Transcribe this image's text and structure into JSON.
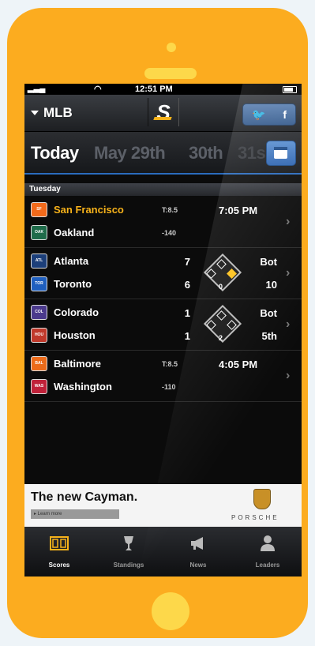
{
  "status": {
    "time": "12:51 PM"
  },
  "nav": {
    "league": "MLB",
    "social": {
      "twitter": "𝕥",
      "facebook": "f"
    }
  },
  "dates": {
    "today": "Today",
    "next1": "May 29th",
    "next2": "30th",
    "next3": "31s"
  },
  "section": {
    "day": "Tuesday"
  },
  "games": [
    {
      "away": {
        "name": "San Francisco",
        "abbr": "SF",
        "color": "#f26a1b",
        "highlight": "#f7b21a"
      },
      "home": {
        "name": "Oakland",
        "abbr": "OAK",
        "color": "#1f6b4a"
      },
      "line_top": "T:8.5",
      "line_bot": "-140",
      "time": "7:05 PM"
    },
    {
      "away": {
        "name": "Atlanta",
        "abbr": "ATL",
        "color": "#1c3f7a",
        "score": "7"
      },
      "home": {
        "name": "Toronto",
        "abbr": "TOR",
        "color": "#1f5fbf",
        "score": "6"
      },
      "inning_half": "Bot",
      "inning": "10",
      "outs": "0"
    },
    {
      "away": {
        "name": "Colorado",
        "abbr": "COL",
        "color": "#4b3a8c",
        "score": "1"
      },
      "home": {
        "name": "Houston",
        "abbr": "HOU",
        "color": "#c0392b",
        "score": "1"
      },
      "inning_half": "Bot",
      "inning": "5th",
      "outs": "2"
    },
    {
      "away": {
        "name": "Baltimore",
        "abbr": "BAL",
        "color": "#ec6b1a"
      },
      "home": {
        "name": "Washington",
        "abbr": "WAS",
        "color": "#c0223a"
      },
      "line_top": "T:8.5",
      "line_bot": "-110",
      "time": "4:05 PM"
    }
  ],
  "ad": {
    "headline": "The new Cayman.",
    "cta": "▸ Learn more",
    "brand": "PORSCHE"
  },
  "tabs": [
    {
      "label": "Scores",
      "icon": "scoreboard-icon"
    },
    {
      "label": "Standings",
      "icon": "trophy-icon"
    },
    {
      "label": "News",
      "icon": "megaphone-icon"
    },
    {
      "label": "Leaders",
      "icon": "person-icon"
    }
  ],
  "colors": {
    "phone": "#fcac1f",
    "accent_blue": "#2a6bbd",
    "highlight": "#f7b21a"
  }
}
